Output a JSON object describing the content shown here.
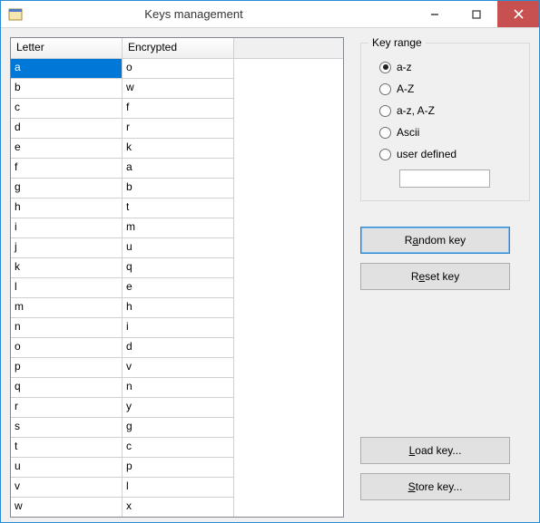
{
  "window": {
    "title": "Keys management"
  },
  "grid": {
    "headers": {
      "letter": "Letter",
      "encrypted": "Encrypted"
    },
    "rows": [
      {
        "letter": "a",
        "encrypted": "o",
        "selected": true
      },
      {
        "letter": "b",
        "encrypted": "w"
      },
      {
        "letter": "c",
        "encrypted": "f"
      },
      {
        "letter": "d",
        "encrypted": "r"
      },
      {
        "letter": "e",
        "encrypted": "k"
      },
      {
        "letter": "f",
        "encrypted": "a"
      },
      {
        "letter": "g",
        "encrypted": "b"
      },
      {
        "letter": "h",
        "encrypted": "t"
      },
      {
        "letter": "i",
        "encrypted": "m"
      },
      {
        "letter": "j",
        "encrypted": "u"
      },
      {
        "letter": "k",
        "encrypted": "q"
      },
      {
        "letter": "l",
        "encrypted": "e"
      },
      {
        "letter": "m",
        "encrypted": "h"
      },
      {
        "letter": "n",
        "encrypted": "i"
      },
      {
        "letter": "o",
        "encrypted": "d"
      },
      {
        "letter": "p",
        "encrypted": "v"
      },
      {
        "letter": "q",
        "encrypted": "n"
      },
      {
        "letter": "r",
        "encrypted": "y"
      },
      {
        "letter": "s",
        "encrypted": "g"
      },
      {
        "letter": "t",
        "encrypted": "c"
      },
      {
        "letter": "u",
        "encrypted": "p"
      },
      {
        "letter": "v",
        "encrypted": "l"
      },
      {
        "letter": "w",
        "encrypted": "x"
      }
    ]
  },
  "keyRange": {
    "legend": "Key range",
    "options": [
      {
        "id": "az",
        "label": "a-z",
        "checked": true
      },
      {
        "id": "AZ",
        "label": "A-Z",
        "checked": false
      },
      {
        "id": "azAZ",
        "label": "a-z, A-Z",
        "checked": false
      },
      {
        "id": "ascii",
        "label": "Ascii",
        "checked": false
      },
      {
        "id": "user",
        "label": "user defined",
        "checked": false
      }
    ],
    "userDefinedValue": ""
  },
  "buttons": {
    "random": {
      "prefix": "R",
      "ul": "a",
      "suffix": "ndom key"
    },
    "reset": {
      "prefix": "R",
      "ul": "e",
      "suffix": "set key"
    },
    "load": {
      "prefix": "",
      "ul": "L",
      "suffix": "oad key..."
    },
    "store": {
      "prefix": "",
      "ul": "S",
      "suffix": "tore key..."
    }
  }
}
